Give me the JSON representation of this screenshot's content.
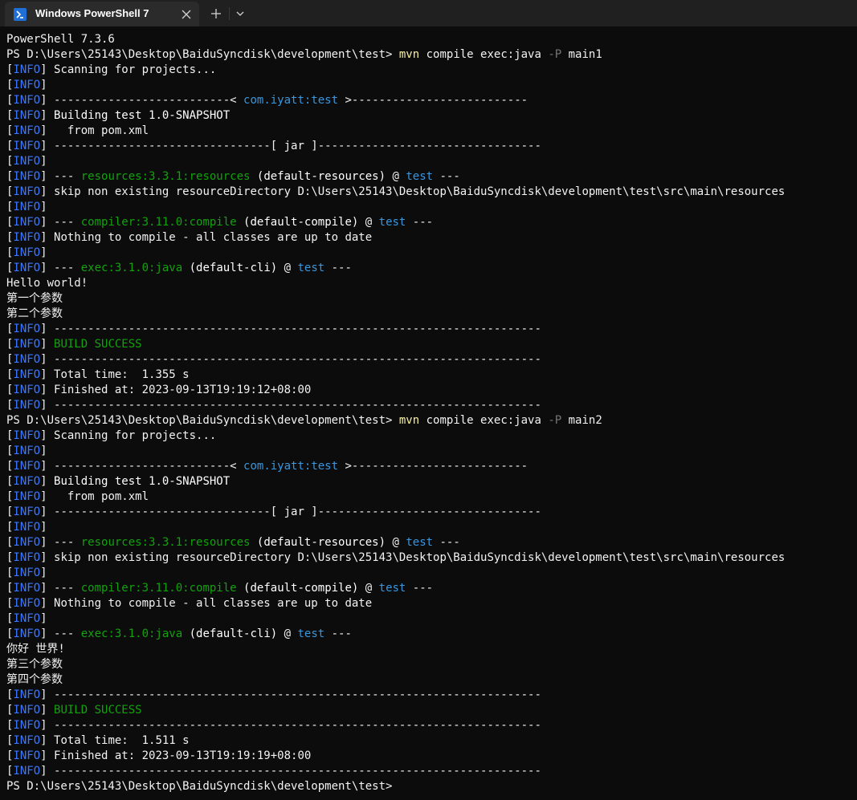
{
  "window": {
    "tab_title": "Windows PowerShell 7",
    "colors": {
      "background": "#0c0c0c",
      "titlebar": "#202020",
      "tab": "#2b2b2b",
      "text": "#cccccc",
      "info_blue": "#3b78ff",
      "artifact_cyan": "#3a96dd",
      "plugin_green": "#13a10e",
      "command_yellow": "#f9f1a5",
      "param_gray": "#767676"
    }
  },
  "terminal": {
    "lines": [
      [
        {
          "t": "PowerShell 7.3.6",
          "c": "w"
        }
      ],
      [
        {
          "t": "PS D:\\Users\\25143\\Desktop\\BaiduSyncdisk\\development\\test> ",
          "c": "w"
        },
        {
          "t": "mvn",
          "c": "y"
        },
        {
          "t": " compile exec:java ",
          "c": "w"
        },
        {
          "t": "-P",
          "c": "d"
        },
        {
          "t": " main1",
          "c": "w"
        }
      ],
      [
        {
          "t": "[",
          "c": "w"
        },
        {
          "t": "INFO",
          "c": "b"
        },
        {
          "t": "] Scanning for projects...",
          "c": "w"
        }
      ],
      [
        {
          "t": "[",
          "c": "w"
        },
        {
          "t": "INFO",
          "c": "b"
        },
        {
          "t": "]",
          "c": "w"
        }
      ],
      [
        {
          "t": "[",
          "c": "w"
        },
        {
          "t": "INFO",
          "c": "b"
        },
        {
          "t": "] --------------------------< ",
          "c": "w"
        },
        {
          "t": "com.iyatt:test",
          "c": "c"
        },
        {
          "t": " >--------------------------",
          "c": "w"
        }
      ],
      [
        {
          "t": "[",
          "c": "w"
        },
        {
          "t": "INFO",
          "c": "b"
        },
        {
          "t": "] ",
          "c": "w"
        },
        {
          "t": "Building test 1.0-SNAPSHOT",
          "c": "bright"
        }
      ],
      [
        {
          "t": "[",
          "c": "w"
        },
        {
          "t": "INFO",
          "c": "b"
        },
        {
          "t": "]   from pom.xml",
          "c": "w"
        }
      ],
      [
        {
          "t": "[",
          "c": "w"
        },
        {
          "t": "INFO",
          "c": "b"
        },
        {
          "t": "] --------------------------------[ jar ]---------------------------------",
          "c": "w"
        }
      ],
      [
        {
          "t": "[",
          "c": "w"
        },
        {
          "t": "INFO",
          "c": "b"
        },
        {
          "t": "]",
          "c": "w"
        }
      ],
      [
        {
          "t": "[",
          "c": "w"
        },
        {
          "t": "INFO",
          "c": "b"
        },
        {
          "t": "] --- ",
          "c": "w"
        },
        {
          "t": "resources:3.3.1:resources",
          "c": "g"
        },
        {
          "t": " ",
          "c": "w"
        },
        {
          "t": "(default-resources)",
          "c": "bright"
        },
        {
          "t": " @ ",
          "c": "w"
        },
        {
          "t": "test",
          "c": "c"
        },
        {
          "t": " ---",
          "c": "w"
        }
      ],
      [
        {
          "t": "[",
          "c": "w"
        },
        {
          "t": "INFO",
          "c": "b"
        },
        {
          "t": "] skip non existing resourceDirectory D:\\Users\\25143\\Desktop\\BaiduSyncdisk\\development\\test\\src\\main\\resources",
          "c": "w"
        }
      ],
      [
        {
          "t": "[",
          "c": "w"
        },
        {
          "t": "INFO",
          "c": "b"
        },
        {
          "t": "]",
          "c": "w"
        }
      ],
      [
        {
          "t": "[",
          "c": "w"
        },
        {
          "t": "INFO",
          "c": "b"
        },
        {
          "t": "] --- ",
          "c": "w"
        },
        {
          "t": "compiler:3.11.0:compile",
          "c": "g"
        },
        {
          "t": " ",
          "c": "w"
        },
        {
          "t": "(default-compile)",
          "c": "bright"
        },
        {
          "t": " @ ",
          "c": "w"
        },
        {
          "t": "test",
          "c": "c"
        },
        {
          "t": " ---",
          "c": "w"
        }
      ],
      [
        {
          "t": "[",
          "c": "w"
        },
        {
          "t": "INFO",
          "c": "b"
        },
        {
          "t": "] Nothing to compile - all classes are up to date",
          "c": "w"
        }
      ],
      [
        {
          "t": "[",
          "c": "w"
        },
        {
          "t": "INFO",
          "c": "b"
        },
        {
          "t": "]",
          "c": "w"
        }
      ],
      [
        {
          "t": "[",
          "c": "w"
        },
        {
          "t": "INFO",
          "c": "b"
        },
        {
          "t": "] --- ",
          "c": "w"
        },
        {
          "t": "exec:3.1.0:java",
          "c": "g"
        },
        {
          "t": " ",
          "c": "w"
        },
        {
          "t": "(default-cli)",
          "c": "bright"
        },
        {
          "t": " @ ",
          "c": "w"
        },
        {
          "t": "test",
          "c": "c"
        },
        {
          "t": " ---",
          "c": "w"
        }
      ],
      [
        {
          "t": "Hello world!",
          "c": "w"
        }
      ],
      [
        {
          "t": "第一个参数",
          "c": "w"
        }
      ],
      [
        {
          "t": "第二个参数",
          "c": "w"
        }
      ],
      [
        {
          "t": "[",
          "c": "w"
        },
        {
          "t": "INFO",
          "c": "b"
        },
        {
          "t": "] ------------------------------------------------------------------------",
          "c": "w"
        }
      ],
      [
        {
          "t": "[",
          "c": "w"
        },
        {
          "t": "INFO",
          "c": "b"
        },
        {
          "t": "] ",
          "c": "w"
        },
        {
          "t": "BUILD SUCCESS",
          "c": "g"
        }
      ],
      [
        {
          "t": "[",
          "c": "w"
        },
        {
          "t": "INFO",
          "c": "b"
        },
        {
          "t": "] ------------------------------------------------------------------------",
          "c": "w"
        }
      ],
      [
        {
          "t": "[",
          "c": "w"
        },
        {
          "t": "INFO",
          "c": "b"
        },
        {
          "t": "] Total time:  1.355 s",
          "c": "w"
        }
      ],
      [
        {
          "t": "[",
          "c": "w"
        },
        {
          "t": "INFO",
          "c": "b"
        },
        {
          "t": "] Finished at: 2023-09-13T19:19:12+08:00",
          "c": "w"
        }
      ],
      [
        {
          "t": "[",
          "c": "w"
        },
        {
          "t": "INFO",
          "c": "b"
        },
        {
          "t": "] ------------------------------------------------------------------------",
          "c": "w"
        }
      ],
      [
        {
          "t": "PS D:\\Users\\25143\\Desktop\\BaiduSyncdisk\\development\\test> ",
          "c": "w"
        },
        {
          "t": "mvn",
          "c": "y"
        },
        {
          "t": " compile exec:java ",
          "c": "w"
        },
        {
          "t": "-P",
          "c": "d"
        },
        {
          "t": " main2",
          "c": "w"
        }
      ],
      [
        {
          "t": "[",
          "c": "w"
        },
        {
          "t": "INFO",
          "c": "b"
        },
        {
          "t": "] Scanning for projects...",
          "c": "w"
        }
      ],
      [
        {
          "t": "[",
          "c": "w"
        },
        {
          "t": "INFO",
          "c": "b"
        },
        {
          "t": "]",
          "c": "w"
        }
      ],
      [
        {
          "t": "[",
          "c": "w"
        },
        {
          "t": "INFO",
          "c": "b"
        },
        {
          "t": "] --------------------------< ",
          "c": "w"
        },
        {
          "t": "com.iyatt:test",
          "c": "c"
        },
        {
          "t": " >--------------------------",
          "c": "w"
        }
      ],
      [
        {
          "t": "[",
          "c": "w"
        },
        {
          "t": "INFO",
          "c": "b"
        },
        {
          "t": "] ",
          "c": "w"
        },
        {
          "t": "Building test 1.0-SNAPSHOT",
          "c": "bright"
        }
      ],
      [
        {
          "t": "[",
          "c": "w"
        },
        {
          "t": "INFO",
          "c": "b"
        },
        {
          "t": "]   from pom.xml",
          "c": "w"
        }
      ],
      [
        {
          "t": "[",
          "c": "w"
        },
        {
          "t": "INFO",
          "c": "b"
        },
        {
          "t": "] --------------------------------[ jar ]---------------------------------",
          "c": "w"
        }
      ],
      [
        {
          "t": "[",
          "c": "w"
        },
        {
          "t": "INFO",
          "c": "b"
        },
        {
          "t": "]",
          "c": "w"
        }
      ],
      [
        {
          "t": "[",
          "c": "w"
        },
        {
          "t": "INFO",
          "c": "b"
        },
        {
          "t": "] --- ",
          "c": "w"
        },
        {
          "t": "resources:3.3.1:resources",
          "c": "g"
        },
        {
          "t": " ",
          "c": "w"
        },
        {
          "t": "(default-resources)",
          "c": "bright"
        },
        {
          "t": " @ ",
          "c": "w"
        },
        {
          "t": "test",
          "c": "c"
        },
        {
          "t": " ---",
          "c": "w"
        }
      ],
      [
        {
          "t": "[",
          "c": "w"
        },
        {
          "t": "INFO",
          "c": "b"
        },
        {
          "t": "] skip non existing resourceDirectory D:\\Users\\25143\\Desktop\\BaiduSyncdisk\\development\\test\\src\\main\\resources",
          "c": "w"
        }
      ],
      [
        {
          "t": "[",
          "c": "w"
        },
        {
          "t": "INFO",
          "c": "b"
        },
        {
          "t": "]",
          "c": "w"
        }
      ],
      [
        {
          "t": "[",
          "c": "w"
        },
        {
          "t": "INFO",
          "c": "b"
        },
        {
          "t": "] --- ",
          "c": "w"
        },
        {
          "t": "compiler:3.11.0:compile",
          "c": "g"
        },
        {
          "t": " ",
          "c": "w"
        },
        {
          "t": "(default-compile)",
          "c": "bright"
        },
        {
          "t": " @ ",
          "c": "w"
        },
        {
          "t": "test",
          "c": "c"
        },
        {
          "t": " ---",
          "c": "w"
        }
      ],
      [
        {
          "t": "[",
          "c": "w"
        },
        {
          "t": "INFO",
          "c": "b"
        },
        {
          "t": "] Nothing to compile - all classes are up to date",
          "c": "w"
        }
      ],
      [
        {
          "t": "[",
          "c": "w"
        },
        {
          "t": "INFO",
          "c": "b"
        },
        {
          "t": "]",
          "c": "w"
        }
      ],
      [
        {
          "t": "[",
          "c": "w"
        },
        {
          "t": "INFO",
          "c": "b"
        },
        {
          "t": "] --- ",
          "c": "w"
        },
        {
          "t": "exec:3.1.0:java",
          "c": "g"
        },
        {
          "t": " ",
          "c": "w"
        },
        {
          "t": "(default-cli)",
          "c": "bright"
        },
        {
          "t": " @ ",
          "c": "w"
        },
        {
          "t": "test",
          "c": "c"
        },
        {
          "t": " ---",
          "c": "w"
        }
      ],
      [
        {
          "t": "你好 世界!",
          "c": "w"
        }
      ],
      [
        {
          "t": "第三个参数",
          "c": "w"
        }
      ],
      [
        {
          "t": "第四个参数",
          "c": "w"
        }
      ],
      [
        {
          "t": "[",
          "c": "w"
        },
        {
          "t": "INFO",
          "c": "b"
        },
        {
          "t": "] ------------------------------------------------------------------------",
          "c": "w"
        }
      ],
      [
        {
          "t": "[",
          "c": "w"
        },
        {
          "t": "INFO",
          "c": "b"
        },
        {
          "t": "] ",
          "c": "w"
        },
        {
          "t": "BUILD SUCCESS",
          "c": "g"
        }
      ],
      [
        {
          "t": "[",
          "c": "w"
        },
        {
          "t": "INFO",
          "c": "b"
        },
        {
          "t": "] ------------------------------------------------------------------------",
          "c": "w"
        }
      ],
      [
        {
          "t": "[",
          "c": "w"
        },
        {
          "t": "INFO",
          "c": "b"
        },
        {
          "t": "] Total time:  1.511 s",
          "c": "w"
        }
      ],
      [
        {
          "t": "[",
          "c": "w"
        },
        {
          "t": "INFO",
          "c": "b"
        },
        {
          "t": "] Finished at: 2023-09-13T19:19:19+08:00",
          "c": "w"
        }
      ],
      [
        {
          "t": "[",
          "c": "w"
        },
        {
          "t": "INFO",
          "c": "b"
        },
        {
          "t": "] ------------------------------------------------------------------------",
          "c": "w"
        }
      ],
      [
        {
          "t": "PS D:\\Users\\25143\\Desktop\\BaiduSyncdisk\\development\\test>",
          "c": "w"
        }
      ]
    ]
  }
}
